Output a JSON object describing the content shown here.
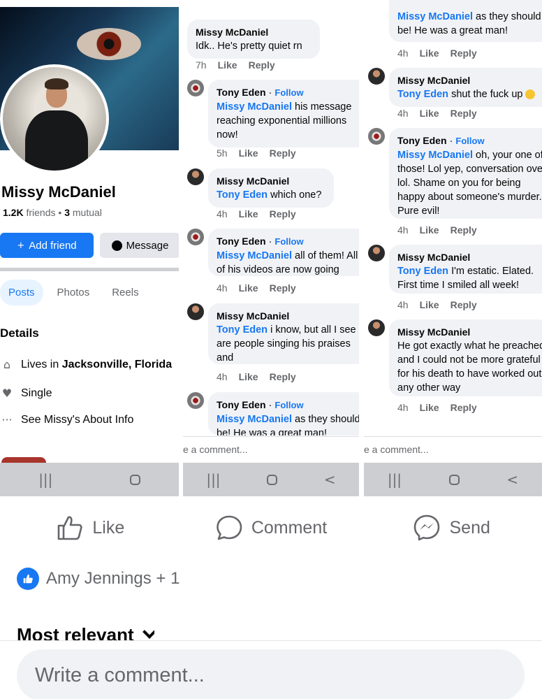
{
  "profile": {
    "name": "Missy McDaniel",
    "friends_count": "1.2K",
    "friends_label": "friends",
    "mutual_count": "3",
    "mutual_label": "mutual",
    "add_friend_label": "Add friend",
    "message_label": "Message",
    "tabs": [
      "Posts",
      "Photos",
      "Reels"
    ],
    "details_heading": "Details",
    "lives_prefix": "Lives in",
    "lives_location": "Jacksonville, Florida",
    "relationship": "Single",
    "about_link": "See Missy's About Info"
  },
  "thread2": [
    {
      "author": "Missy McDaniel",
      "text": "Idk.. He's pretty quiet rn",
      "time": "7h"
    },
    {
      "author": "Tony Eden",
      "follow": "Follow",
      "mention": "Missy McDaniel",
      "text": "his message reaching exponential millions now!",
      "time": "5h"
    },
    {
      "author": "Missy McDaniel",
      "mention": "Tony Eden",
      "text": "which one?",
      "time": "4h"
    },
    {
      "author": "Tony Eden",
      "follow": "Follow",
      "mention": "Missy McDaniel",
      "text": "all of them! All of his videos are now going viral",
      "time": "4h"
    },
    {
      "author": "Missy McDaniel",
      "mention": "Tony Eden",
      "text": "i know, but all I see are people singing his praises and",
      "time": "4h"
    },
    {
      "author": "Tony Eden",
      "follow": "Follow",
      "mention": "Missy McDaniel",
      "text": "as they should be! He was a great man!"
    }
  ],
  "thread3": [
    {
      "mention": "Missy McDaniel",
      "text": "as they should be! He was a great man!",
      "time": "4h"
    },
    {
      "author": "Missy McDaniel",
      "mention": "Tony Eden",
      "text": "shut the fuck up",
      "time": "4h"
    },
    {
      "author": "Tony Eden",
      "follow": "Follow",
      "mention": "Missy McDaniel",
      "text": "oh, your one of those! Lol yep, conversation over lol. Shame on you for being happy about someone's murder. Pure evil!",
      "time": "4h"
    },
    {
      "author": "Missy McDaniel",
      "mention": "Tony Eden",
      "text": "I'm estatic. Elated. First time I smiled all week!",
      "time": "4h"
    },
    {
      "author": "Missy McDaniel",
      "text": "He got exactly what he preached and I could not be more grateful for his death to have worked out any other way",
      "time": "4h"
    }
  ],
  "comment_actions": {
    "like": "Like",
    "reply": "Reply"
  },
  "write_comment_cropped": "e a comment...",
  "post_actions": {
    "like": "Like",
    "comment": "Comment",
    "send": "Send"
  },
  "reactions_text": "Amy Jennings + 1",
  "sort_label": "Most relevant",
  "compose_placeholder": "Write a comment...",
  "colors": {
    "accent": "#1877f2",
    "bubble": "#f0f2f5",
    "muted": "#65676b"
  }
}
